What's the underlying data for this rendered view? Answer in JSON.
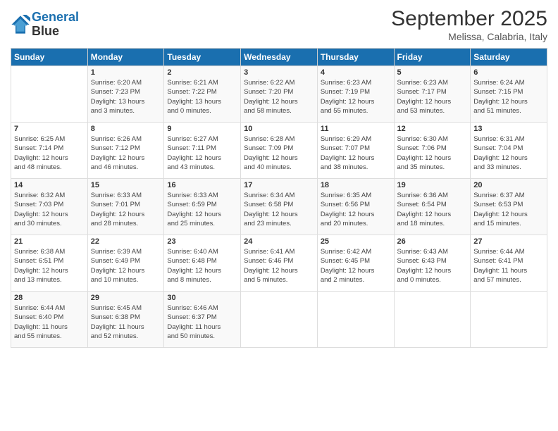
{
  "header": {
    "logo_line1": "General",
    "logo_line2": "Blue",
    "month_title": "September 2025",
    "location": "Melissa, Calabria, Italy"
  },
  "days_of_week": [
    "Sunday",
    "Monday",
    "Tuesday",
    "Wednesday",
    "Thursday",
    "Friday",
    "Saturday"
  ],
  "weeks": [
    [
      {
        "day": "",
        "info": ""
      },
      {
        "day": "1",
        "info": "Sunrise: 6:20 AM\nSunset: 7:23 PM\nDaylight: 13 hours\nand 3 minutes."
      },
      {
        "day": "2",
        "info": "Sunrise: 6:21 AM\nSunset: 7:22 PM\nDaylight: 13 hours\nand 0 minutes."
      },
      {
        "day": "3",
        "info": "Sunrise: 6:22 AM\nSunset: 7:20 PM\nDaylight: 12 hours\nand 58 minutes."
      },
      {
        "day": "4",
        "info": "Sunrise: 6:23 AM\nSunset: 7:19 PM\nDaylight: 12 hours\nand 55 minutes."
      },
      {
        "day": "5",
        "info": "Sunrise: 6:23 AM\nSunset: 7:17 PM\nDaylight: 12 hours\nand 53 minutes."
      },
      {
        "day": "6",
        "info": "Sunrise: 6:24 AM\nSunset: 7:15 PM\nDaylight: 12 hours\nand 51 minutes."
      }
    ],
    [
      {
        "day": "7",
        "info": "Sunrise: 6:25 AM\nSunset: 7:14 PM\nDaylight: 12 hours\nand 48 minutes."
      },
      {
        "day": "8",
        "info": "Sunrise: 6:26 AM\nSunset: 7:12 PM\nDaylight: 12 hours\nand 46 minutes."
      },
      {
        "day": "9",
        "info": "Sunrise: 6:27 AM\nSunset: 7:11 PM\nDaylight: 12 hours\nand 43 minutes."
      },
      {
        "day": "10",
        "info": "Sunrise: 6:28 AM\nSunset: 7:09 PM\nDaylight: 12 hours\nand 40 minutes."
      },
      {
        "day": "11",
        "info": "Sunrise: 6:29 AM\nSunset: 7:07 PM\nDaylight: 12 hours\nand 38 minutes."
      },
      {
        "day": "12",
        "info": "Sunrise: 6:30 AM\nSunset: 7:06 PM\nDaylight: 12 hours\nand 35 minutes."
      },
      {
        "day": "13",
        "info": "Sunrise: 6:31 AM\nSunset: 7:04 PM\nDaylight: 12 hours\nand 33 minutes."
      }
    ],
    [
      {
        "day": "14",
        "info": "Sunrise: 6:32 AM\nSunset: 7:03 PM\nDaylight: 12 hours\nand 30 minutes."
      },
      {
        "day": "15",
        "info": "Sunrise: 6:33 AM\nSunset: 7:01 PM\nDaylight: 12 hours\nand 28 minutes."
      },
      {
        "day": "16",
        "info": "Sunrise: 6:33 AM\nSunset: 6:59 PM\nDaylight: 12 hours\nand 25 minutes."
      },
      {
        "day": "17",
        "info": "Sunrise: 6:34 AM\nSunset: 6:58 PM\nDaylight: 12 hours\nand 23 minutes."
      },
      {
        "day": "18",
        "info": "Sunrise: 6:35 AM\nSunset: 6:56 PM\nDaylight: 12 hours\nand 20 minutes."
      },
      {
        "day": "19",
        "info": "Sunrise: 6:36 AM\nSunset: 6:54 PM\nDaylight: 12 hours\nand 18 minutes."
      },
      {
        "day": "20",
        "info": "Sunrise: 6:37 AM\nSunset: 6:53 PM\nDaylight: 12 hours\nand 15 minutes."
      }
    ],
    [
      {
        "day": "21",
        "info": "Sunrise: 6:38 AM\nSunset: 6:51 PM\nDaylight: 12 hours\nand 13 minutes."
      },
      {
        "day": "22",
        "info": "Sunrise: 6:39 AM\nSunset: 6:49 PM\nDaylight: 12 hours\nand 10 minutes."
      },
      {
        "day": "23",
        "info": "Sunrise: 6:40 AM\nSunset: 6:48 PM\nDaylight: 12 hours\nand 8 minutes."
      },
      {
        "day": "24",
        "info": "Sunrise: 6:41 AM\nSunset: 6:46 PM\nDaylight: 12 hours\nand 5 minutes."
      },
      {
        "day": "25",
        "info": "Sunrise: 6:42 AM\nSunset: 6:45 PM\nDaylight: 12 hours\nand 2 minutes."
      },
      {
        "day": "26",
        "info": "Sunrise: 6:43 AM\nSunset: 6:43 PM\nDaylight: 12 hours\nand 0 minutes."
      },
      {
        "day": "27",
        "info": "Sunrise: 6:44 AM\nSunset: 6:41 PM\nDaylight: 11 hours\nand 57 minutes."
      }
    ],
    [
      {
        "day": "28",
        "info": "Sunrise: 6:44 AM\nSunset: 6:40 PM\nDaylight: 11 hours\nand 55 minutes."
      },
      {
        "day": "29",
        "info": "Sunrise: 6:45 AM\nSunset: 6:38 PM\nDaylight: 11 hours\nand 52 minutes."
      },
      {
        "day": "30",
        "info": "Sunrise: 6:46 AM\nSunset: 6:37 PM\nDaylight: 11 hours\nand 50 minutes."
      },
      {
        "day": "",
        "info": ""
      },
      {
        "day": "",
        "info": ""
      },
      {
        "day": "",
        "info": ""
      },
      {
        "day": "",
        "info": ""
      }
    ]
  ]
}
